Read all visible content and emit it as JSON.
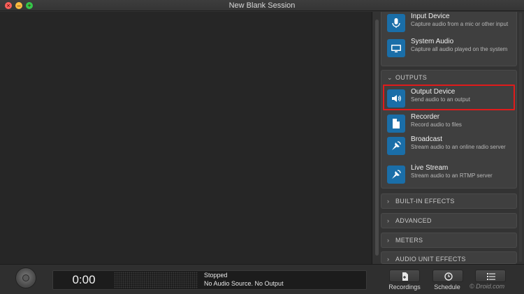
{
  "window": {
    "title": "New Blank Session"
  },
  "sources": {
    "items": [
      {
        "name": "Input Device",
        "desc": "Capture audio from a mic or other input",
        "icon": "microphone-icon"
      },
      {
        "name": "System Audio",
        "desc": "Capture all audio played on the system",
        "icon": "monitor-icon"
      }
    ]
  },
  "outputs": {
    "header": "OUTPUTS",
    "items": [
      {
        "name": "Output Device",
        "desc": "Send audio to an output",
        "icon": "speaker-icon"
      },
      {
        "name": "Recorder",
        "desc": "Record audio to files",
        "icon": "file-icon"
      },
      {
        "name": "Broadcast",
        "desc": "Stream audio to an online radio server",
        "icon": "broadcast-icon"
      },
      {
        "name": "Live Stream",
        "desc": "Stream audio to an RTMP server",
        "icon": "live-stream-icon"
      }
    ]
  },
  "sections": {
    "built_in": "BUILT-IN EFFECTS",
    "advanced": "ADVANCED",
    "meters": "METERS",
    "audio_unit": "AUDIO UNIT EFFECTS"
  },
  "status": {
    "time": "0:00",
    "state": "Stopped",
    "detail": "No Audio Source. No Output"
  },
  "toolbar": {
    "recordings": "Recordings",
    "schedule": "Schedule"
  },
  "watermark": "© Droid.com",
  "colors": {
    "accent": "#1a6ea8",
    "highlight": "#e01b1b"
  }
}
